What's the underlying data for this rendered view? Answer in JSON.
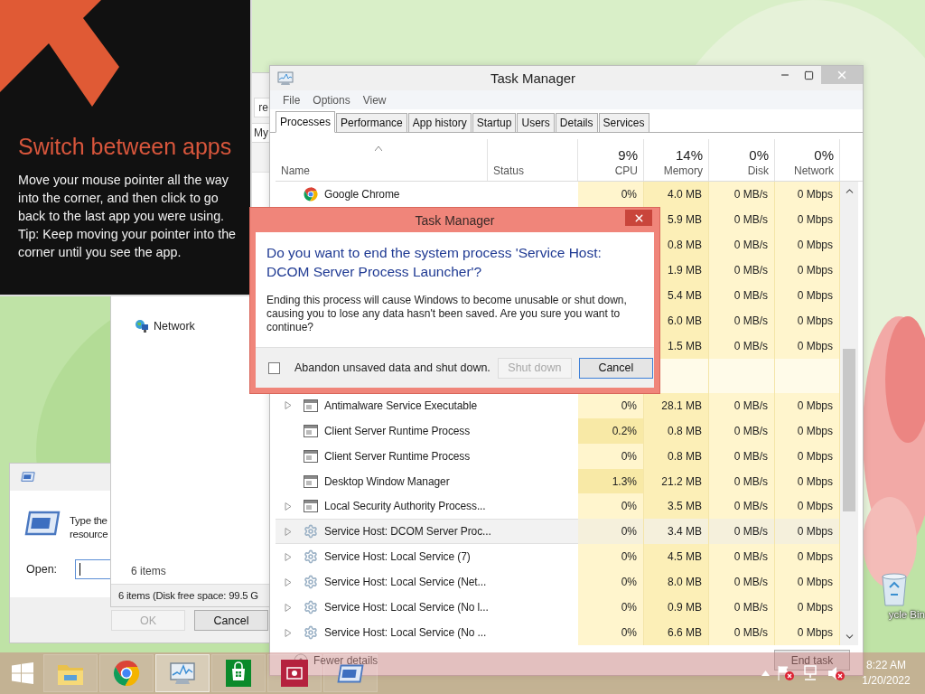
{
  "tip": {
    "title": "Switch between apps",
    "body": [
      "Move your mouse pointer all the way into the corner, and then click to go back to the last app you were using.",
      "Tip: Keep moving your pointer into the corner until you see the app."
    ]
  },
  "explorer": {
    "fields": [
      "re",
      "My"
    ],
    "items": [
      {
        "label": "Network"
      }
    ],
    "item_count": "6 items",
    "status_bar": "6 items (Disk free space: 99.5 G"
  },
  "run_dialog": {
    "prompt": [
      "Type the",
      "resource"
    ],
    "open_label": "Open:",
    "buttons": [
      {
        "label": "OK",
        "disabled": true
      },
      {
        "label": "Cancel",
        "disabled": false
      }
    ]
  },
  "task_manager": {
    "title": "Task Manager",
    "menu": [
      "File",
      "Options",
      "View"
    ],
    "tabs": [
      {
        "label": "Processes",
        "selected": true
      },
      {
        "label": "Performance",
        "selected": false
      },
      {
        "label": "App history",
        "selected": false
      },
      {
        "label": "Startup",
        "selected": false
      },
      {
        "label": "Users",
        "selected": false
      },
      {
        "label": "Details",
        "selected": false
      },
      {
        "label": "Services",
        "selected": false
      }
    ],
    "columns": [
      {
        "label": "Name"
      },
      {
        "label": "Status"
      },
      {
        "usage": "9%",
        "label": "CPU"
      },
      {
        "usage": "14%",
        "label": "Memory"
      },
      {
        "usage": "0%",
        "label": "Disk"
      },
      {
        "usage": "0%",
        "label": "Network"
      }
    ],
    "rows": [
      {
        "kind": "chrome",
        "name": "Google Chrome",
        "expandable": false,
        "selected": false,
        "cpu": "0%",
        "memory": "4.0 MB",
        "disk": "0 MB/s",
        "network": "0 Mbps"
      },
      {
        "kind": "process",
        "memory": "5.9 MB",
        "disk": "0 MB/s",
        "network": "0 Mbps"
      },
      {
        "kind": "process",
        "memory": "0.8 MB",
        "disk": "0 MB/s",
        "network": "0 Mbps"
      },
      {
        "kind": "process",
        "memory": "1.9 MB",
        "disk": "0 MB/s",
        "network": "0 Mbps"
      },
      {
        "kind": "process",
        "memory": "5.4 MB",
        "disk": "0 MB/s",
        "network": "0 Mbps"
      },
      {
        "kind": "process",
        "memory": "6.0 MB",
        "disk": "0 MB/s",
        "network": "0 Mbps"
      },
      {
        "kind": "process",
        "memory": "1.5 MB",
        "disk": "0 MB/s",
        "network": "0 Mbps"
      },
      {
        "kind": "group"
      },
      {
        "kind": "app",
        "name": "Antimalware Service Executable",
        "expandable": true,
        "selected": false,
        "cpu": "0%",
        "memory": "28.1 MB",
        "disk": "0 MB/s",
        "network": "0 Mbps"
      },
      {
        "kind": "app",
        "name": "Client Server Runtime Process",
        "expandable": false,
        "selected": false,
        "cpu": "0.2%",
        "memory": "0.8 MB",
        "disk": "0 MB/s",
        "network": "0 Mbps"
      },
      {
        "kind": "app",
        "name": "Client Server Runtime Process",
        "expandable": false,
        "selected": false,
        "cpu": "0%",
        "memory": "0.8 MB",
        "disk": "0 MB/s",
        "network": "0 Mbps"
      },
      {
        "kind": "app",
        "name": "Desktop Window Manager",
        "expandable": false,
        "selected": false,
        "cpu": "1.3%",
        "memory": "21.2 MB",
        "disk": "0 MB/s",
        "network": "0 Mbps"
      },
      {
        "kind": "app",
        "name": "Local Security Authority Process...",
        "expandable": true,
        "selected": false,
        "cpu": "0%",
        "memory": "3.5 MB",
        "disk": "0 MB/s",
        "network": "0 Mbps"
      },
      {
        "kind": "service",
        "name": "Service Host: DCOM Server Proc...",
        "expandable": true,
        "selected": true,
        "cpu": "0%",
        "memory": "3.4 MB",
        "disk": "0 MB/s",
        "network": "0 Mbps"
      },
      {
        "kind": "service",
        "name": "Service Host: Local Service (7)",
        "expandable": true,
        "selected": false,
        "cpu": "0%",
        "memory": "4.5 MB",
        "disk": "0 MB/s",
        "network": "0 Mbps"
      },
      {
        "kind": "service",
        "name": "Service Host: Local Service (Net...",
        "expandable": true,
        "selected": false,
        "cpu": "0%",
        "memory": "8.0 MB",
        "disk": "0 MB/s",
        "network": "0 Mbps"
      },
      {
        "kind": "service",
        "name": "Service Host: Local Service (No l...",
        "expandable": true,
        "selected": false,
        "cpu": "0%",
        "memory": "0.9 MB",
        "disk": "0 MB/s",
        "network": "0 Mbps"
      },
      {
        "kind": "service",
        "name": "Service Host: Local Service (No ...",
        "expandable": true,
        "selected": false,
        "cpu": "0%",
        "memory": "6.6 MB",
        "disk": "0 MB/s",
        "network": "0 Mbps"
      }
    ],
    "footer": {
      "fewer_details": "Fewer details",
      "end_task": "End task"
    }
  },
  "confirm_dialog": {
    "title": "Task Manager",
    "question": "Do you want to end the system process 'Service Host: DCOM Server Process Launcher'?",
    "message": "Ending this process will cause Windows to become unusable or shut down, causing you to lose any data hasn't been saved. Are you sure you want to continue?",
    "checkbox": {
      "label": "Abandon unsaved data and shut down.",
      "checked": false
    },
    "buttons": [
      {
        "label": "Shut down",
        "disabled": true
      },
      {
        "label": "Cancel",
        "disabled": false
      }
    ]
  },
  "desktop_icons": [
    {
      "label": "ycle Bin"
    }
  ],
  "taskbar": {
    "apps": [
      {
        "kind": "explorer",
        "active": false
      },
      {
        "kind": "chrome",
        "active": false
      },
      {
        "kind": "taskmanager",
        "active": true
      },
      {
        "kind": "store",
        "active": false
      },
      {
        "kind": "media",
        "active": false
      },
      {
        "kind": "run",
        "active": false
      }
    ],
    "clock": {
      "time": "8:22 AM",
      "date": "1/20/2022"
    }
  }
}
